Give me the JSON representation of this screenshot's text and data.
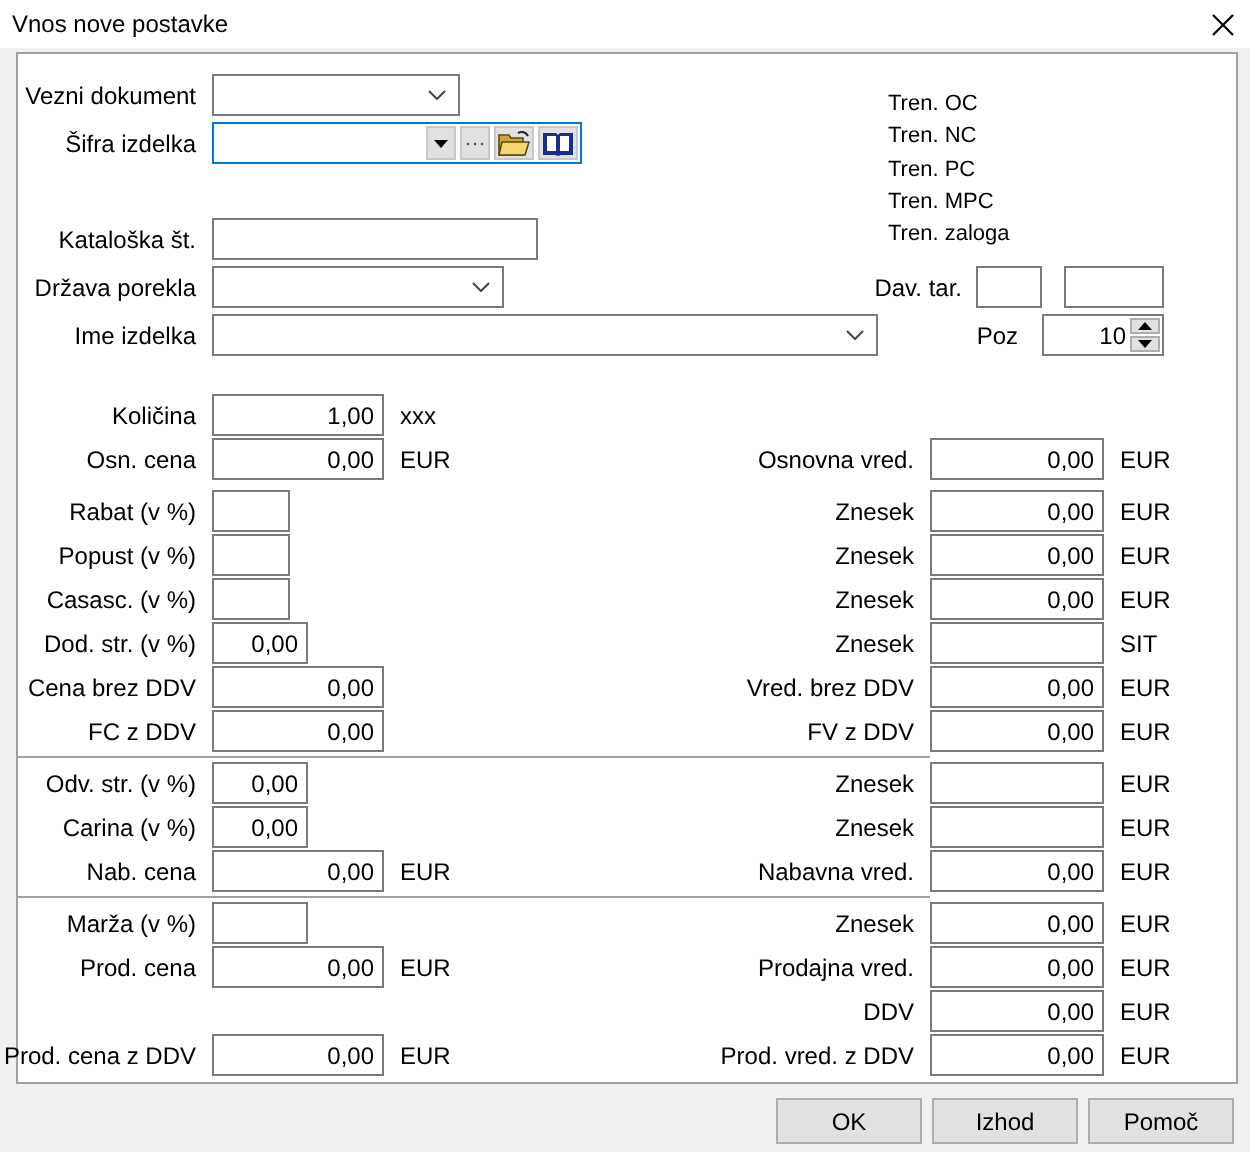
{
  "window": {
    "title": "Vnos nove postavke"
  },
  "header_fields": [
    {
      "label": "Vezni dokument",
      "kind": "combo",
      "focused": false
    },
    {
      "label": "Šifra izdelka",
      "kind": "lookup",
      "focused": true
    },
    {
      "label": "Kataloška št.",
      "kind": "text",
      "focused": false
    },
    {
      "label": "Država porekla",
      "kind": "combo",
      "focused": false
    },
    {
      "label": "Ime izdelka",
      "kind": "combo",
      "focused": false
    }
  ],
  "current_values": [
    "Tren. OC",
    "Tren. NC",
    "Tren. PC",
    "Tren. MPC",
    "Tren. zaloga"
  ],
  "tariff": {
    "label": "Dav. tar."
  },
  "position": {
    "label": "Poz",
    "value": "10"
  },
  "sections": [
    {
      "rows": [
        {
          "left": {
            "label": "Količina",
            "kind": "amount",
            "value": "1,00",
            "unit": "xxx"
          }
        },
        {
          "left": {
            "label": "Osn. cena",
            "kind": "amount",
            "value": "0,00",
            "unit": "EUR"
          },
          "right": {
            "label": "Osnovna vred.",
            "value": "0,00",
            "unit": "EUR"
          }
        },
        {
          "left": {
            "label": "Rabat (v %)",
            "kind": "narrow"
          },
          "right": {
            "label": "Znesek",
            "value": "0,00",
            "unit": "EUR"
          }
        },
        {
          "left": {
            "label": "Popust (v %)",
            "kind": "narrow"
          },
          "right": {
            "label": "Znesek",
            "value": "0,00",
            "unit": "EUR"
          }
        },
        {
          "left": {
            "label": "Casasc. (v %)",
            "kind": "narrow"
          },
          "right": {
            "label": "Znesek",
            "value": "0,00",
            "unit": "EUR"
          }
        },
        {
          "left": {
            "label": "Dod. str. (v %)",
            "kind": "percent",
            "value": "0,00"
          },
          "right": {
            "label": "Znesek",
            "unit": "SIT"
          }
        },
        {
          "left": {
            "label": "Cena brez DDV",
            "kind": "amount",
            "value": "0,00"
          },
          "right": {
            "label": "Vred. brez DDV",
            "value": "0,00",
            "unit": "EUR"
          }
        },
        {
          "left": {
            "label": "FC z DDV",
            "kind": "amount",
            "value": "0,00"
          },
          "right": {
            "label": "FV z DDV",
            "value": "0,00",
            "unit": "EUR"
          }
        }
      ]
    },
    {
      "rows": [
        {
          "left": {
            "label": "Odv. str. (v %)",
            "kind": "percent",
            "value": "0,00"
          },
          "right": {
            "label": "Znesek",
            "unit": "EUR"
          }
        },
        {
          "left": {
            "label": "Carina (v %)",
            "kind": "percent",
            "value": "0,00"
          },
          "right": {
            "label": "Znesek",
            "unit": "EUR"
          }
        },
        {
          "left": {
            "label": "Nab. cena",
            "kind": "amount",
            "value": "0,00",
            "unit": "EUR"
          },
          "right": {
            "label": "Nabavna vred.",
            "value": "0,00",
            "unit": "EUR"
          }
        }
      ]
    },
    {
      "rows": [
        {
          "left": {
            "label": "Marža (v %)",
            "kind": "percent"
          },
          "right": {
            "label": "Znesek",
            "value": "0,00",
            "unit": "EUR"
          }
        },
        {
          "left": {
            "label": "Prod. cena",
            "kind": "amount",
            "value": "0,00",
            "unit": "EUR"
          },
          "right": {
            "label": "Prodajna vred.",
            "value": "0,00",
            "unit": "EUR"
          }
        },
        {
          "right": {
            "label": "DDV",
            "value": "0,00",
            "unit": "EUR"
          }
        },
        {
          "left": {
            "label": "Prod. cena z DDV",
            "kind": "amount",
            "value": "0,00",
            "unit": "EUR"
          },
          "right": {
            "label": "Prod. vred. z DDV",
            "value": "0,00",
            "unit": "EUR"
          }
        }
      ]
    }
  ],
  "buttons": [
    "OK",
    "Izhod",
    "Pomoč"
  ]
}
